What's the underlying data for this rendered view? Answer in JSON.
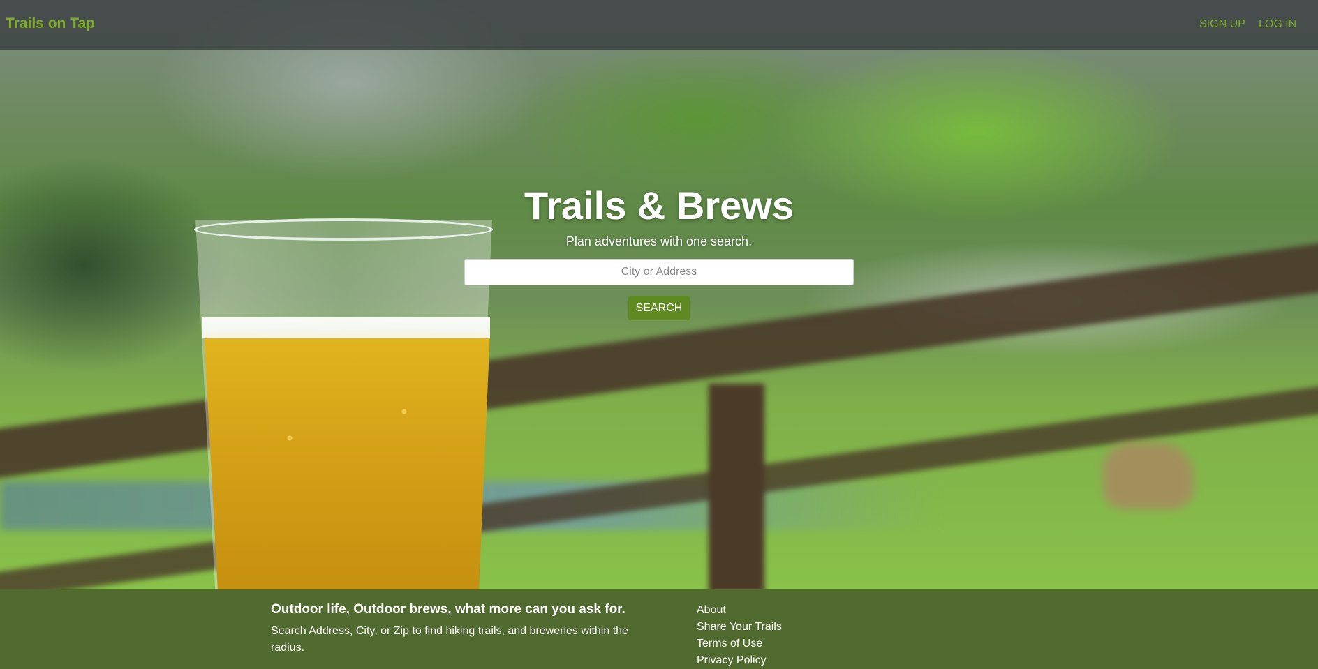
{
  "nav": {
    "brand": "Trails on Tap",
    "links": [
      "SIGN UP",
      "LOG IN"
    ]
  },
  "hero": {
    "title": "Trails & Brews",
    "subtitle": "Plan adventures with one search.",
    "search_placeholder": "City or Address",
    "search_button": "SEARCH"
  },
  "footer": {
    "heading": "Outdoor life, Outdoor brews, what more can you ask for.",
    "text": "Search Address, City, or Zip to find hiking trails, and breweries within the radius.",
    "links": [
      "About",
      "Share Your Trails",
      "Terms of Use",
      "Privacy Policy"
    ]
  },
  "colors": {
    "brand": "#7fad2a",
    "button": "#5f8a22",
    "footer_bg": "#516a2f"
  }
}
